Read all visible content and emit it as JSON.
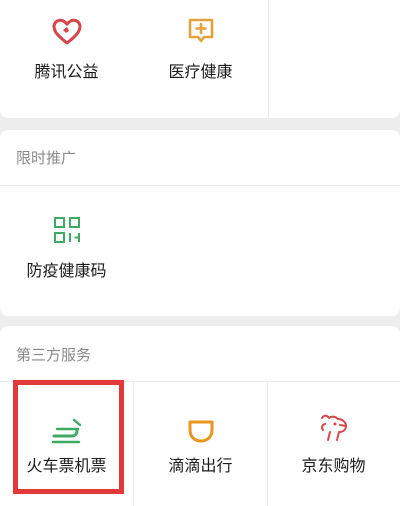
{
  "top_row": {
    "items": [
      {
        "label": "腾讯公益",
        "icon": "heart-charity-icon",
        "color": "#d5464b"
      },
      {
        "label": "医疗健康",
        "icon": "medical-plus-icon",
        "color": "#e3a23d"
      }
    ]
  },
  "promo": {
    "title": "限时推广",
    "items": [
      {
        "label": "防疫健康码",
        "icon": "qr-code-icon",
        "color": "#3eaa64"
      }
    ]
  },
  "third_party": {
    "title": "第三方服务",
    "items": [
      {
        "label": "火车票机票",
        "icon": "train-plane-icon",
        "color": "#3eaa64"
      },
      {
        "label": "滴滴出行",
        "icon": "didi-icon",
        "color": "#e8961e"
      },
      {
        "label": "京东购物",
        "icon": "jd-dog-icon",
        "color": "#d8484a"
      }
    ]
  },
  "highlight_color": "#e23a3a"
}
